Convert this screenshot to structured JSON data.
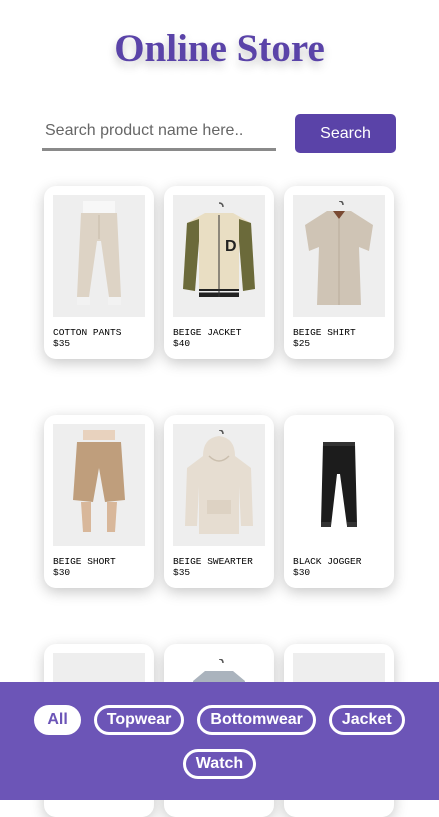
{
  "header": {
    "title": "Online Store"
  },
  "search": {
    "placeholder": "Search product name here..",
    "value": "",
    "button_label": "Search"
  },
  "products": [
    {
      "name": "COTTON PANTS",
      "price": "$35",
      "image": "pants-image"
    },
    {
      "name": "BEIGE JACKET",
      "price": "$40",
      "image": "jacket-image"
    },
    {
      "name": "BEIGE SHIRT",
      "price": "$25",
      "image": "shirt-image"
    },
    {
      "name": "BEIGE SHORT",
      "price": "$30",
      "image": "shorts-image"
    },
    {
      "name": "BEIGE SWEARTER",
      "price": "$35",
      "image": "hoodie-image"
    },
    {
      "name": "BLACK JOGGER",
      "price": "$30",
      "image": "jogger-image"
    },
    {
      "name": "",
      "price": "",
      "image": "product-image"
    },
    {
      "name": "",
      "price": "",
      "image": "product-image"
    },
    {
      "name": "",
      "price": "",
      "image": "product-image"
    }
  ],
  "filters": [
    {
      "label": "All",
      "active": true
    },
    {
      "label": "Topwear",
      "active": false
    },
    {
      "label": "Bottomwear",
      "active": false
    },
    {
      "label": "Jacket",
      "active": false
    },
    {
      "label": "Watch",
      "active": false
    }
  ],
  "colors": {
    "accent": "#5a43a8",
    "filter_bar": "#6c55b7"
  }
}
